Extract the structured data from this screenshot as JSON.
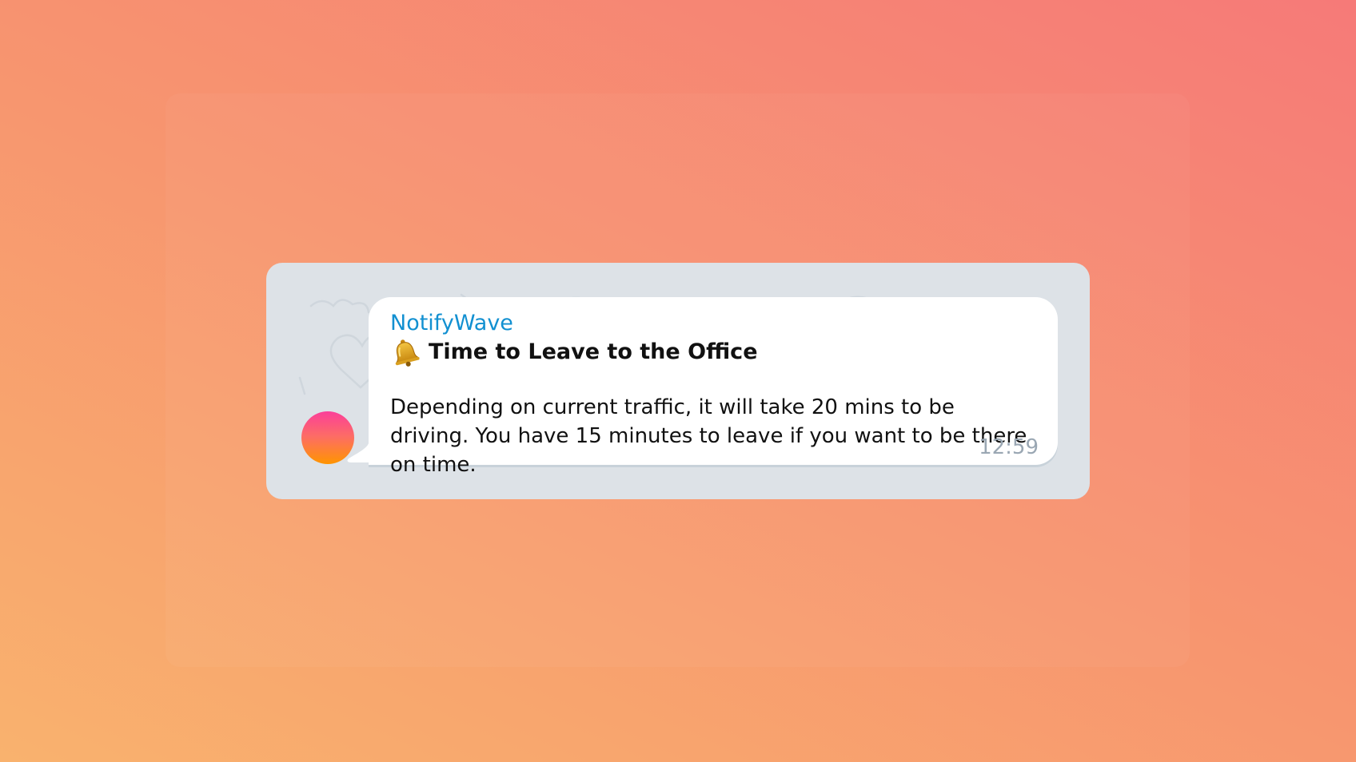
{
  "message": {
    "sender": "NotifyWave",
    "title_icon": "bell-icon",
    "title": "Time to Leave to the Office",
    "body": "Depending on current traffic, it will take 20 mins to be driving. You have 15 minutes to leave if you want to be there on time.",
    "time": "12:59"
  },
  "colors": {
    "sender": "#1290d1",
    "frame_bg": "#dde2e7",
    "bubble_bg": "#ffffff",
    "timestamp": "#9aa7b3",
    "avatar_top": "#fb3f9a",
    "avatar_bottom": "#ff9500"
  }
}
